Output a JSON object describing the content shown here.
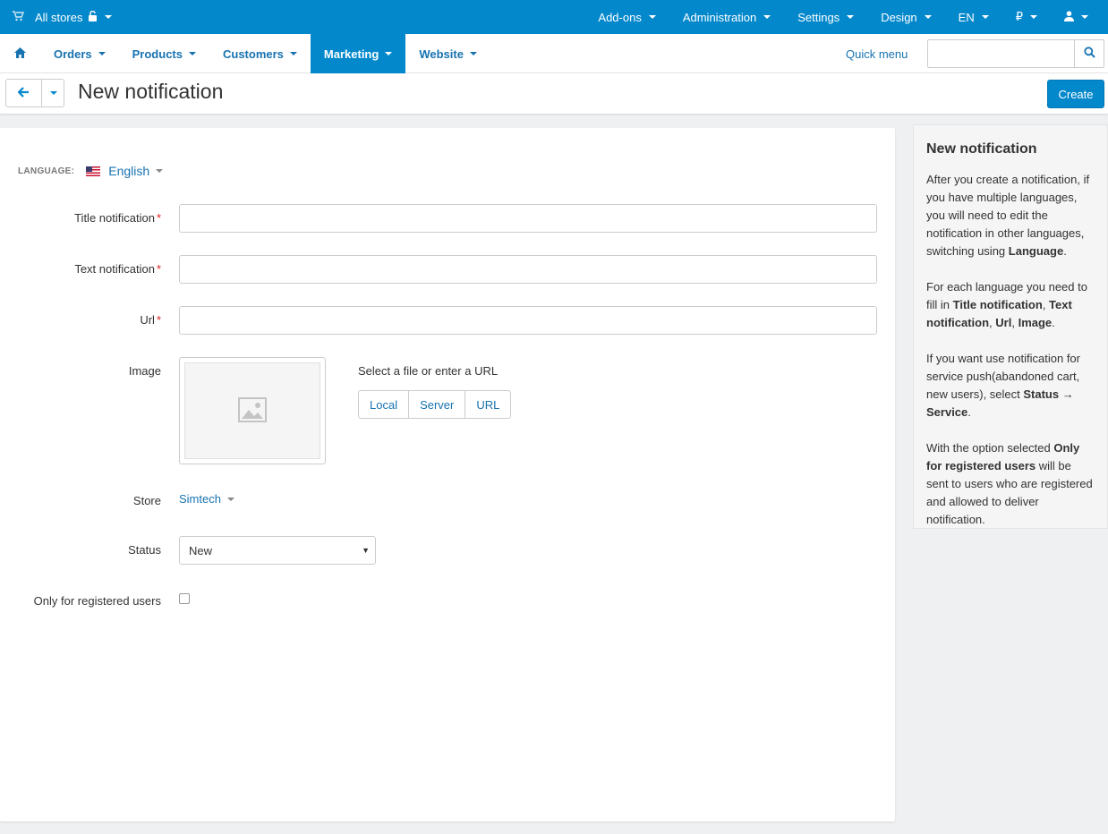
{
  "topbar": {
    "store_label": "All stores",
    "items": [
      "Add-ons",
      "Administration",
      "Settings",
      "Design",
      "EN",
      "₽"
    ]
  },
  "nav": {
    "items": [
      "Orders",
      "Products",
      "Customers",
      "Marketing",
      "Website"
    ],
    "active": "Marketing",
    "quick_menu": "Quick menu",
    "search_placeholder": ""
  },
  "header": {
    "title": "New notification",
    "create_label": "Create"
  },
  "form": {
    "language_label": "LANGUAGE:",
    "language_value": "English",
    "title_label": "Title notification",
    "title_value": "",
    "text_label": "Text notification",
    "text_value": "",
    "url_label": "Url",
    "url_value": "",
    "required_mark": "*",
    "image_label": "Image",
    "select_file_text": "Select a file or enter a URL",
    "image_sources": [
      "Local",
      "Server",
      "URL"
    ],
    "store_label": "Store",
    "store_value": "Simtech",
    "status_label": "Status",
    "status_value": "New",
    "registered_label": "Only for registered users",
    "registered_checked": false
  },
  "sidebar": {
    "title": "New notification",
    "p1": {
      "a": "After you create a notification, if you have multiple languages, you will need to edit the notification in other languages, switching using ",
      "b1": "Language",
      "c": "."
    },
    "p2": {
      "a": "For each language you need to fill in ",
      "b1": "Title notification",
      "s1": ", ",
      "b2": "Text notification",
      "s2": ", ",
      "b3": "Url",
      "s3": ", ",
      "b4": "Image",
      "c": "."
    },
    "p3": {
      "a": "If you want use notification for service push(abandoned cart, new users), select ",
      "b1": "Status → Service",
      "c": "."
    },
    "p4": {
      "a": "With the option selected ",
      "b1": "Only for registered users",
      "c": " will be sent to users who are registered and allowed to deliver notification."
    }
  },
  "colors": {
    "primary": "#0388cc",
    "link": "#1773b1",
    "required": "#dd2222"
  }
}
